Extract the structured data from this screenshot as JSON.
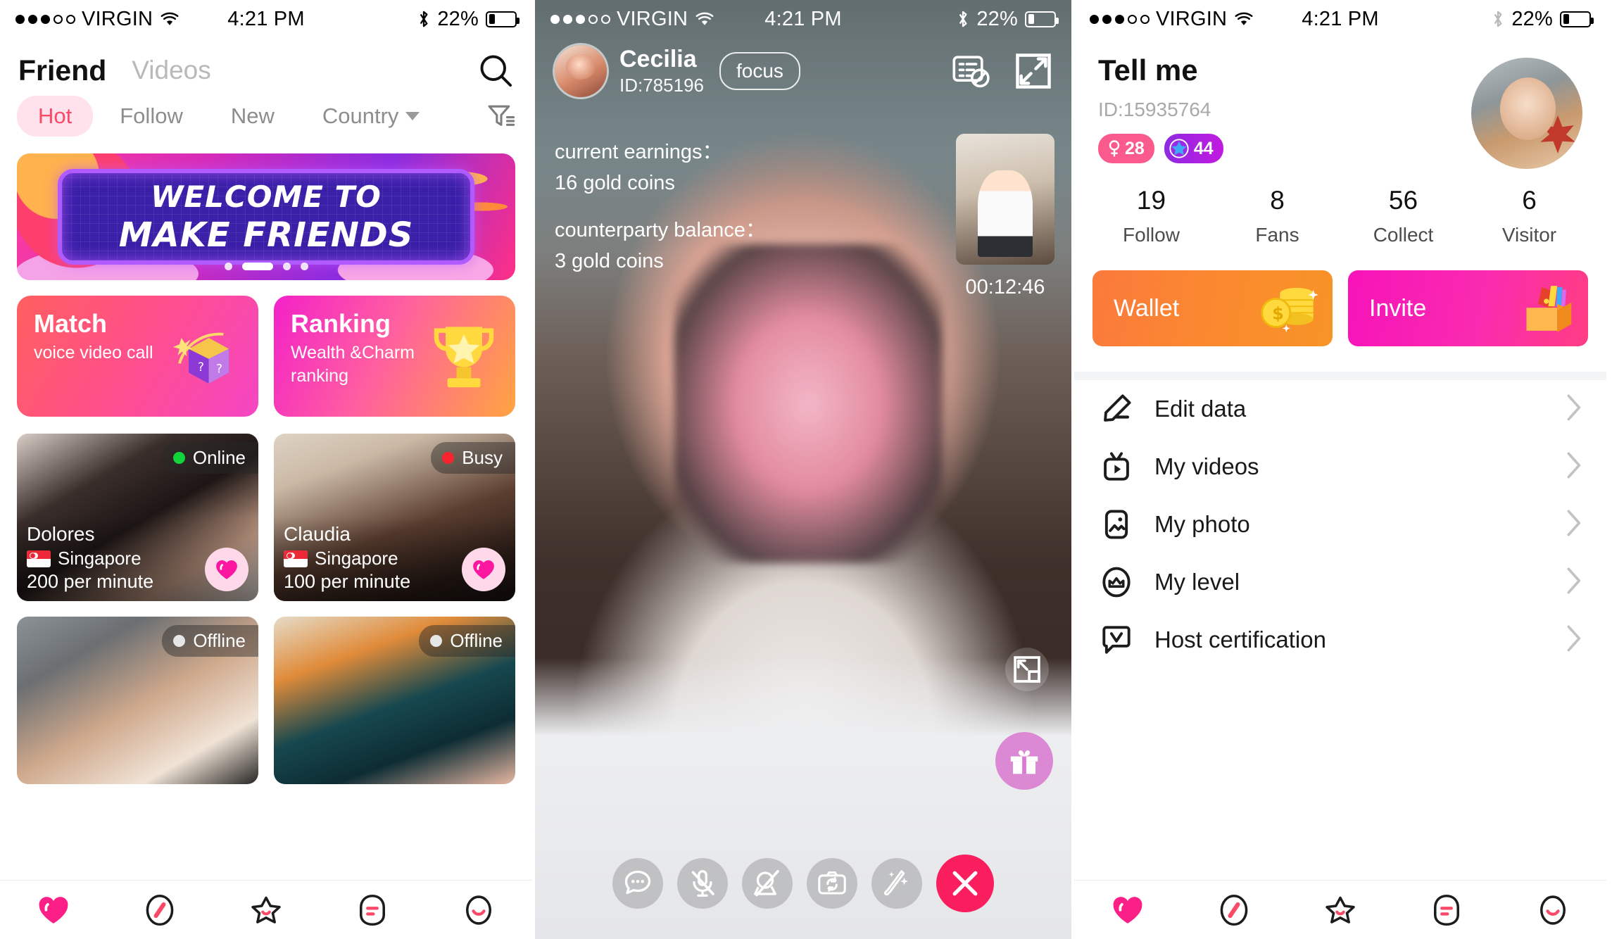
{
  "status_bar": {
    "carrier": "VIRGIN",
    "signal_dots_filled": 3,
    "signal_dots_total": 5,
    "time": "4:21 PM",
    "battery_percent": "22%",
    "bluetooth_icon": "bluetooth-icon",
    "wifi_icon": "wifi-icon"
  },
  "friend_screen": {
    "title": "Friend",
    "secondary_tab": "Videos",
    "search_icon": "search-icon",
    "filter_icon": "filter-icon",
    "filters": [
      {
        "label": "Hot",
        "active": true
      },
      {
        "label": "Follow",
        "active": false
      },
      {
        "label": "New",
        "active": false
      },
      {
        "label": "Country",
        "active": false,
        "dropdown": true
      }
    ],
    "banner": {
      "line1": "WELCOME TO",
      "line2": "MAKE FRIENDS",
      "dots_total": 4,
      "active_dot_index": 1
    },
    "promos": [
      {
        "title": "Match",
        "subtitle": "voice video call",
        "art": "mystery-box-icon",
        "accent": "#ff4f8b"
      },
      {
        "title": "Ranking",
        "subtitle": "Wealth &Charm ranking",
        "art": "trophy-icon",
        "accent": "#ffa441"
      }
    ],
    "cards": [
      {
        "name": "Dolores",
        "country": "Singapore",
        "rate": "200 per minute",
        "status": "Online",
        "status_type": "on"
      },
      {
        "name": "Claudia",
        "country": "Singapore",
        "rate": "100 per minute",
        "status": "Busy",
        "status_type": "busy"
      },
      {
        "name": "",
        "country": "",
        "rate": "",
        "status": "Offline",
        "status_type": "off"
      },
      {
        "name": "",
        "country": "",
        "rate": "",
        "status": "Offline",
        "status_type": "off"
      }
    ]
  },
  "call_screen": {
    "user_name": "Cecilia",
    "user_id": "ID:785196",
    "focus_button": "focus",
    "earnings_label": "current earnings：",
    "earnings_value": "16 gold coins",
    "balance_label": "counterparty balance：",
    "balance_value": "3 gold coins",
    "timer": "00:12:46",
    "header_icons": [
      "no-messages-icon",
      "expand-icon"
    ],
    "pip_resize_icon": "collapse-icon",
    "gift_icon": "gift-icon",
    "controls": [
      {
        "name": "chat-icon",
        "label": "chat"
      },
      {
        "name": "mic-off-icon",
        "label": "mute"
      },
      {
        "name": "camera-off-icon",
        "label": "camera off"
      },
      {
        "name": "switch-camera-icon",
        "label": "switch camera"
      },
      {
        "name": "beauty-wand-icon",
        "label": "beauty"
      },
      {
        "name": "end-call-icon",
        "label": "end call"
      }
    ],
    "end_call_color": "#fa1e5e"
  },
  "profile_screen": {
    "title": "Tell me",
    "id": "ID:15935764",
    "gender_badge": {
      "icon": "female-icon",
      "value": "28"
    },
    "level_badge": {
      "icon": "star-icon",
      "value": "44"
    },
    "avatar": "user-avatar",
    "stats": [
      {
        "value": "19",
        "label": "Follow"
      },
      {
        "value": "8",
        "label": "Fans"
      },
      {
        "value": "56",
        "label": "Collect"
      },
      {
        "value": "6",
        "label": "Visitor"
      }
    ],
    "action_buttons": [
      {
        "label": "Wallet",
        "art": "gold-coins-icon",
        "color": "#fb8a2e"
      },
      {
        "label": "Invite",
        "art": "gift-box-icon",
        "color": "#fa2bb0"
      }
    ],
    "menu": [
      {
        "label": "Edit data",
        "icon": "pencil-icon"
      },
      {
        "label": "My videos",
        "icon": "tv-play-icon"
      },
      {
        "label": "My photo",
        "icon": "photo-icon"
      },
      {
        "label": "My level",
        "icon": "crown-icon"
      },
      {
        "label": "Host certification",
        "icon": "verified-chat-icon"
      }
    ]
  },
  "tabbar": {
    "items": [
      {
        "icon": "heart-icon",
        "active": true
      },
      {
        "icon": "compass-icon",
        "active": false
      },
      {
        "icon": "star-icon",
        "active": false
      },
      {
        "icon": "message-icon",
        "active": false
      },
      {
        "icon": "profile-icon",
        "active": false
      }
    ],
    "active_color": "#fb1f87"
  }
}
